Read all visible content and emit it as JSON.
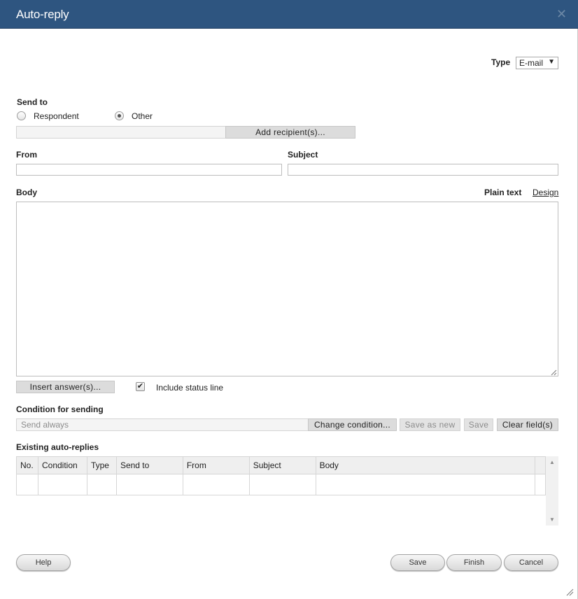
{
  "dialog": {
    "title": "Auto-reply",
    "close_glyph": "✕"
  },
  "type": {
    "label": "Type",
    "value": "E-mail",
    "arrow": "▼"
  },
  "send_to": {
    "label": "Send to",
    "options": [
      "Respondent",
      "Other"
    ],
    "selected": "Other",
    "recipients_value": "",
    "add_button": "Add recipient(s)..."
  },
  "from": {
    "label": "From",
    "value": ""
  },
  "subject": {
    "label": "Subject",
    "value": ""
  },
  "body": {
    "label": "Body",
    "mode_plain": "Plain text",
    "mode_design": "Design",
    "value": ""
  },
  "insert_button": "Insert answer(s)...",
  "status_line": {
    "label": "Include status line",
    "checked": true,
    "check_glyph": "✔"
  },
  "condition": {
    "label": "Condition for sending",
    "value": "Send always",
    "change_button": "Change condition...",
    "save_as_new_button": "Save as new",
    "save_button": "Save",
    "clear_button": "Clear field(s)"
  },
  "existing": {
    "label": "Existing auto-replies",
    "columns": [
      "No.",
      "Condition",
      "Type",
      "Send to",
      "From",
      "Subject",
      "Body"
    ],
    "rows": [
      [
        "",
        "",
        "",
        "",
        "",
        "",
        ""
      ]
    ]
  },
  "scroll": {
    "up": "▲",
    "down": "▼"
  },
  "footer": {
    "help": "Help",
    "save": "Save",
    "finish": "Finish",
    "cancel": "Cancel"
  },
  "icons": {
    "close": "close-icon",
    "dropdown": "chevron-down-icon",
    "check": "checkmark-icon",
    "resize": "resize-grip-icon"
  }
}
